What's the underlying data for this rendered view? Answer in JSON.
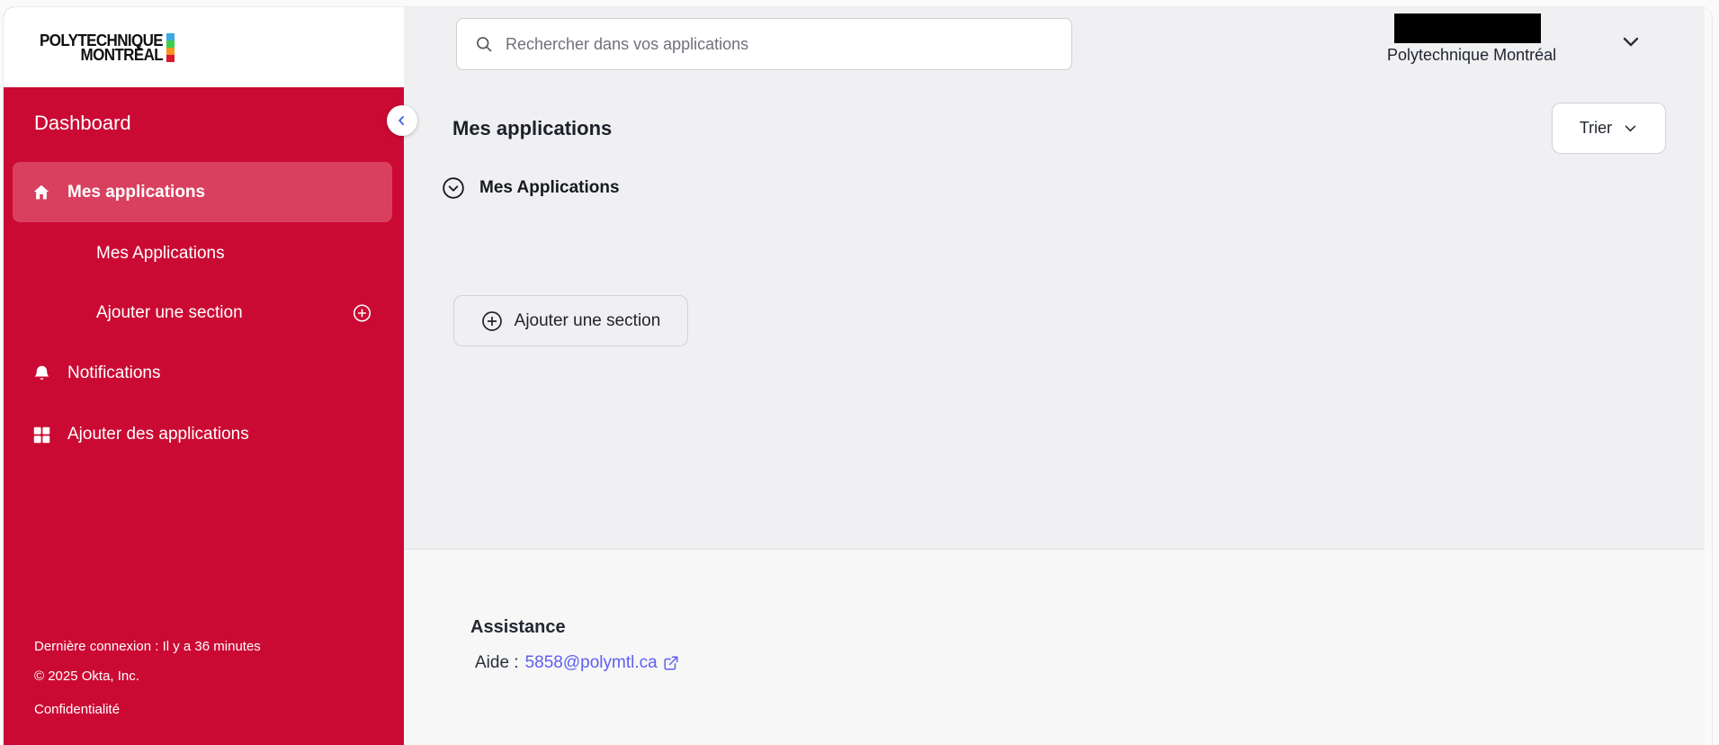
{
  "brand": {
    "name_line1": "POLYTECHNIQUE",
    "name_line2": "MONTRÉAL",
    "square_colors": [
      "#39a9e0",
      "#3fcf4a",
      "#f7941d",
      "#d8192f"
    ]
  },
  "sidebar": {
    "title": "Dashboard",
    "items": [
      {
        "label": "Mes applications",
        "icon": "home",
        "selected": true
      },
      {
        "label": "Mes Applications",
        "selected": false
      },
      {
        "label": "Ajouter une section",
        "icon_right": "plus-circle",
        "selected": false
      },
      {
        "label": "Notifications",
        "icon": "bell",
        "selected": false
      },
      {
        "label": "Ajouter des applications",
        "icon": "apps-grid",
        "selected": false
      }
    ],
    "footer": {
      "last_connection": "Dernière connexion : Il y a 36 minutes",
      "copyright": "© 2025 Okta, Inc.",
      "privacy": "Confidentialité"
    },
    "colors": {
      "background": "#cb0a33",
      "selected_item": "#d9405f"
    }
  },
  "topbar": {
    "search_placeholder": "Rechercher dans vos applications",
    "org_name": "Polytechnique Montréal"
  },
  "main": {
    "heading": "Mes applications",
    "sort_button": "Trier",
    "section_title": "Mes Applications",
    "add_section_button": "Ajouter une section"
  },
  "assistance": {
    "title": "Assistance",
    "help_prefix": "Aide :",
    "help_email": "5858@polymtl.ca"
  }
}
